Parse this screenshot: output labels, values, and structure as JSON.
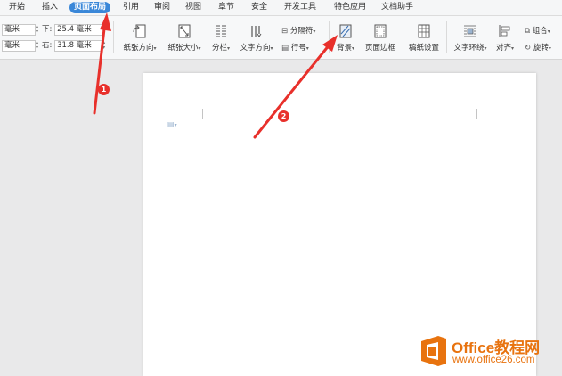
{
  "menu": {
    "tabs": [
      {
        "label": "开始"
      },
      {
        "label": "插入"
      },
      {
        "label": "页面布局"
      },
      {
        "label": "引用"
      },
      {
        "label": "审阅"
      },
      {
        "label": "视图"
      },
      {
        "label": "章节"
      },
      {
        "label": "安全"
      },
      {
        "label": "开发工具"
      },
      {
        "label": "特色应用"
      },
      {
        "label": "文档助手"
      }
    ],
    "active_tab": "页面布局"
  },
  "margins": {
    "top_unit": "毫米",
    "left_unit": "毫米",
    "bottom_label": "下:",
    "bottom_value": "25.4 毫米",
    "right_label": "右:",
    "right_value": "31.8 毫米"
  },
  "ribbon": {
    "orientation": "纸张方向",
    "size": "纸张大小",
    "columns": "分栏",
    "text_direction": "文字方向",
    "separator": "分隔符",
    "line_numbers": "行号",
    "background": "背景",
    "page_border": "页面边框",
    "draft_settings": "稿纸设置",
    "text_wrap": "文字环绕",
    "align": "对齐",
    "group": "组合",
    "rotate": "旋转"
  },
  "annotations": {
    "badge1": "1",
    "badge2": "2"
  },
  "watermark": {
    "title": "Office教程网",
    "url": "www.office26.com"
  },
  "colors": {
    "active_tab": "#3a87d8",
    "annotation": "#e8302b",
    "watermark": "#e8730f"
  }
}
